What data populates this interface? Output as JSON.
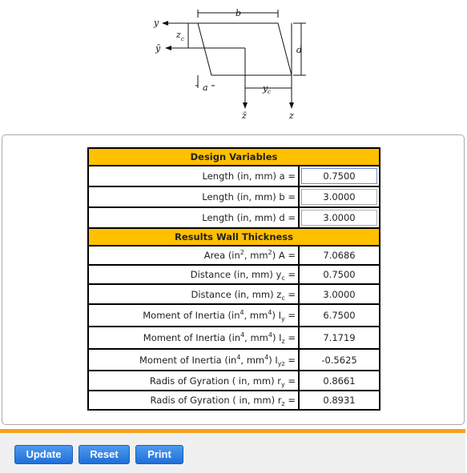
{
  "diagram": {
    "labels": {
      "b": "b",
      "d": "d",
      "a": "a",
      "y": "y",
      "ybar": "ȳ",
      "zc": "z",
      "zc_sub": "c",
      "yc": "y",
      "yc_sub": "c",
      "z": "z",
      "zbar": "z̄"
    }
  },
  "design": {
    "title": "Design Variables",
    "rows": [
      {
        "label": "Length (in, mm) a =",
        "value": "0.7500"
      },
      {
        "label": "Length (in, mm) b =",
        "value": "3.0000"
      },
      {
        "label": "Length (in, mm) d =",
        "value": "3.0000"
      }
    ]
  },
  "results": {
    "title": "Results Wall Thickness",
    "rows": [
      {
        "pre": "Area (in",
        "sup1": "2",
        "mid": ", mm",
        "sup2": "2",
        "post": ") A =",
        "value": "7.0686"
      },
      {
        "pre": "Distance (in, mm) y",
        "sub": "c",
        "post": " =",
        "value": "0.7500"
      },
      {
        "pre": "Distance (in, mm) z",
        "sub": "c",
        "post": " =",
        "value": "3.0000"
      },
      {
        "pre": "Moment of Inertia (in",
        "sup1": "4",
        "mid": ", mm",
        "sup2": "4",
        "post": ") I",
        "sub": "y",
        "post2": " =",
        "value": "6.7500"
      },
      {
        "pre": "Moment of Inertia (in",
        "sup1": "4",
        "mid": ", mm",
        "sup2": "4",
        "post": ") I",
        "sub": "z",
        "post2": " =",
        "value": "7.1719"
      },
      {
        "pre": "Moment of Inertia (in",
        "sup1": "4",
        "mid": ", mm",
        "sup2": "4",
        "post": ") I",
        "sub": "yz",
        "post2": " =",
        "value": "-0.5625"
      },
      {
        "pre": "Radis of Gyration ( in, mm) r",
        "sub": "y",
        "post": " =",
        "value": "0.8661"
      },
      {
        "pre": "Radis of Gyration ( in, mm) r",
        "sub": "z",
        "post": " =",
        "value": "0.8931"
      }
    ]
  },
  "buttons": {
    "update": "Update",
    "reset": "Reset",
    "print": "Print"
  },
  "colors": {
    "header": "#ffc000",
    "accent_bar": "#f5a31a",
    "button": "#1f6fd8"
  }
}
